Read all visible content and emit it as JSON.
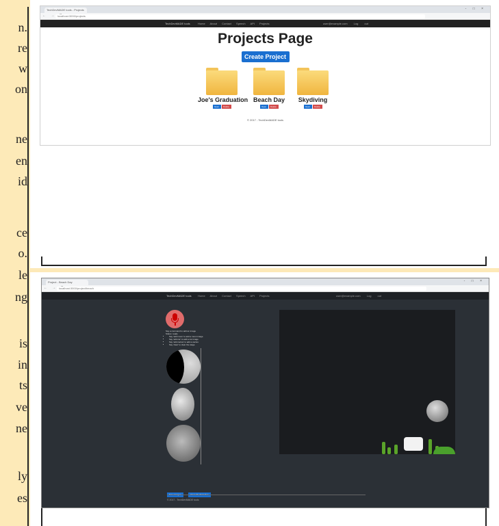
{
  "side_fragments": [
    "n.",
    "re",
    "w",
    "on",
    "ne",
    "en",
    "id",
    "ce",
    "o.",
    "le",
    "ng",
    "is",
    "in",
    "ts",
    "ve",
    "ne",
    "ly",
    "es"
  ],
  "window1": {
    "tab_title": "TechDevMADE tools - Projects",
    "url": "localhost:3000/projects",
    "window_controls": "- □ ×",
    "nav_buttons": "← → C",
    "navbar": {
      "brand": "TechDevMADE tools",
      "links": "Home  About  Contact  Speech API  Projects",
      "right": "user@example.com  Log out"
    },
    "title": "Projects Page",
    "create_button": "Create Project",
    "folders": [
      {
        "name": "Joe's Graduation",
        "open": "Open",
        "delete": "Delete"
      },
      {
        "name": "Beach Day",
        "open": "Open",
        "delete": "Delete"
      },
      {
        "name": "Skydiving",
        "open": "Open",
        "delete": "Delete"
      }
    ],
    "footer": "© 2017 - TechDevMADE tools"
  },
  "window2": {
    "tab_title": "Project - Beach Day",
    "url": "localhost:3000/project/beach",
    "window_controls": "- □ ×",
    "nav_buttons": "← → C",
    "navbar": {
      "brand": "TechDevMADE tools",
      "links": "Home  About  Contact  Speech API  Projects",
      "right": "user@example.com  Log out"
    },
    "info_lines": [
      "Say a command to add an image",
      "Status: ready"
    ],
    "info_list": [
      "Say 'add moon' to add a moon image",
      "Say 'add car' to add a car image",
      "Say 'add cactus' to add a cactus",
      "Say 'clear' to clear the stage"
    ],
    "buttons": [
      "Save Images",
      "Clear All / Start New"
    ],
    "footer": "© 2017 - TechDevMADE tools"
  }
}
